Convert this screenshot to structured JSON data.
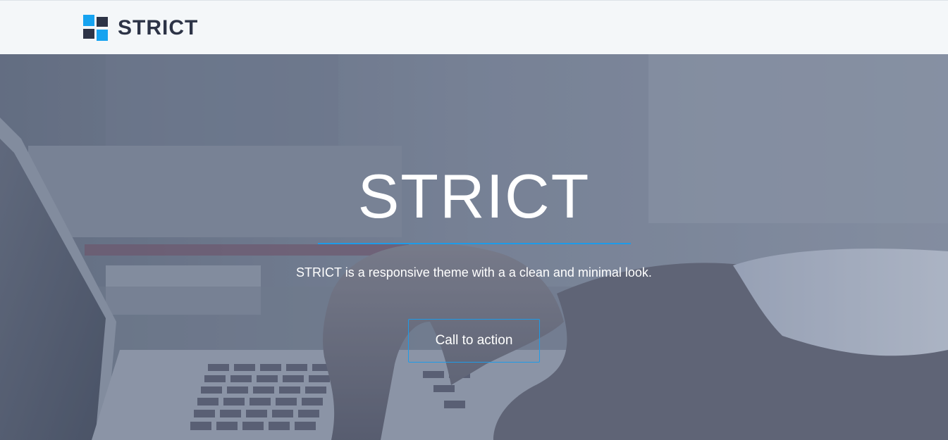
{
  "header": {
    "logo_text": "STRICT",
    "logo_icon": "four-squares-logo-icon"
  },
  "hero": {
    "title": "STRICT",
    "subtitle": "STRICT is a responsive theme with a a clean and minimal look.",
    "cta_label": "Call to action",
    "background_image": "laptop-typing-photo"
  },
  "colors": {
    "accent": "#1e9be8",
    "brand_dark": "#2d3447",
    "header_bg": "#f4f7f9",
    "logo_blue": "#16a3f0"
  }
}
